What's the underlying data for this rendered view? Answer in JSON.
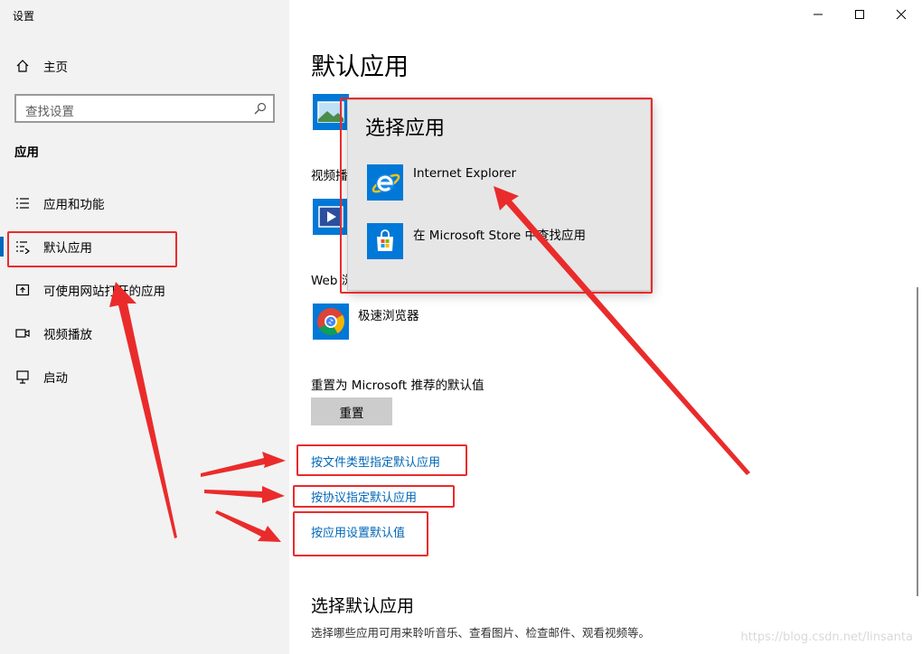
{
  "window": {
    "title": "设置"
  },
  "sidebar": {
    "home": "主页",
    "search_placeholder": "查找设置",
    "section": "应用",
    "items": [
      {
        "label": "应用和功能",
        "icon": "apps-features-icon"
      },
      {
        "label": "默认应用",
        "icon": "default-apps-icon"
      },
      {
        "label": "可使用网站打开的应用",
        "icon": "apps-for-websites-icon"
      },
      {
        "label": "视频播放",
        "icon": "video-playback-icon"
      },
      {
        "label": "启动",
        "icon": "startup-icon"
      }
    ]
  },
  "main": {
    "title": "默认应用",
    "video_label": "视频播",
    "web_label": "Web 浏",
    "browser_name": "极速浏览器",
    "reset_label": "重置为 Microsoft 推荐的默认值",
    "reset_button": "重置",
    "links": [
      "按文件类型指定默认应用",
      "按协议指定默认应用",
      "按应用设置默认值"
    ],
    "section2_title": "选择默认应用",
    "section2_desc": "选择哪些应用可用来聆听音乐、查看图片、检查邮件、观看视频等。"
  },
  "popup": {
    "title": "选择应用",
    "items": [
      {
        "label": "Internet Explorer",
        "icon": "internet-explorer-icon"
      },
      {
        "label": "在 Microsoft Store 中查找应用",
        "icon": "microsoft-store-icon"
      }
    ]
  },
  "watermark": "https://blog.csdn.net/linsanta",
  "colors": {
    "accent": "#0067b8",
    "annotation": "#ea2b2b",
    "sidebar_bg": "#f2f2f2"
  }
}
